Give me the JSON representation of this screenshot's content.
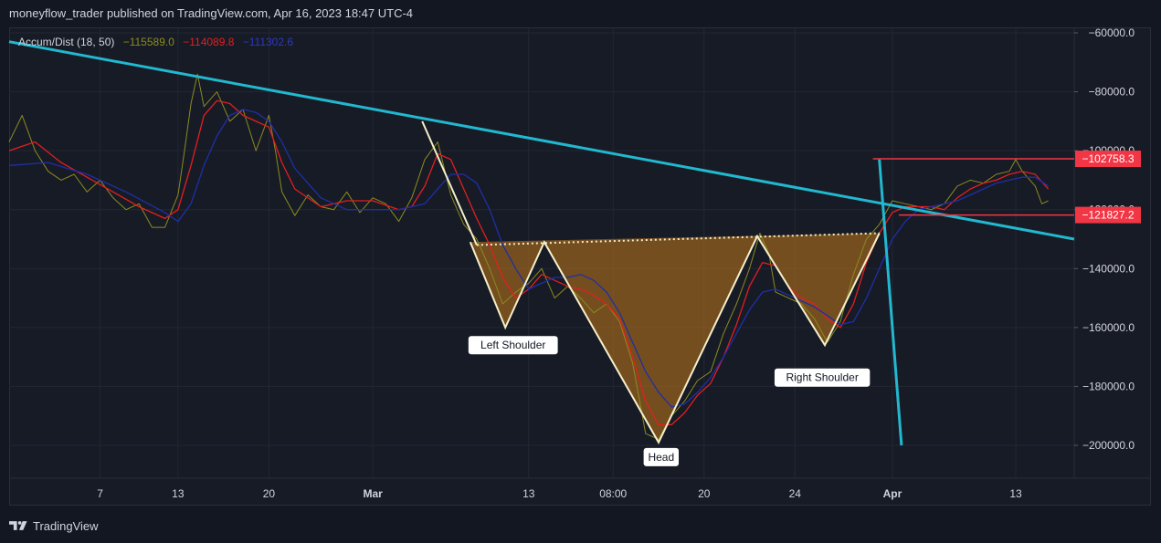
{
  "header": {
    "text": "moneyflow_trader published on TradingView.com, Apr 16, 2023 18:47 UTC-4"
  },
  "footer": {
    "brand": "TradingView",
    "logo_icon": "tradingview-logo-icon"
  },
  "indicator": {
    "name": "Accum/Dist (18, 50)",
    "value1": "−115589.0",
    "value2": "−114089.8",
    "value3": "−111302.6",
    "colors": {
      "raw": "#8b8b1e",
      "fast": "#e21f1f",
      "slow": "#1f2fa8"
    }
  },
  "chart_data": {
    "type": "line",
    "ylim": [
      -212000,
      -60000
    ],
    "y_ticks": [
      {
        "value": -60000,
        "label": "−60000.0"
      },
      {
        "value": -80000,
        "label": "−80000.0"
      },
      {
        "value": -100000,
        "label": "−100000.0"
      },
      {
        "value": -120000,
        "label": "−120000.0"
      },
      {
        "value": -140000,
        "label": "−140000.0"
      },
      {
        "value": -160000,
        "label": "−160000.0"
      },
      {
        "value": -180000,
        "label": "−180000.0"
      },
      {
        "value": -200000,
        "label": "−200000.0"
      }
    ],
    "x_ticks": [
      {
        "t": 7,
        "label": "7",
        "bold": false
      },
      {
        "t": 13,
        "label": "13",
        "bold": false
      },
      {
        "t": 20,
        "label": "20",
        "bold": false
      },
      {
        "t": 28,
        "label": "Mar",
        "bold": true
      },
      {
        "t": 40,
        "label": "13",
        "bold": false
      },
      {
        "t": 46.5,
        "label": "08:00",
        "bold": false
      },
      {
        "t": 53.5,
        "label": "20",
        "bold": false
      },
      {
        "t": 60.5,
        "label": "24",
        "bold": false
      },
      {
        "t": 68,
        "label": "Apr",
        "bold": true
      },
      {
        "t": 77.5,
        "label": "13",
        "bold": false
      }
    ],
    "xlim": [
      0,
      82
    ],
    "series": [
      {
        "role": "raw",
        "points": [
          [
            0,
            -97000
          ],
          [
            1,
            -88000
          ],
          [
            2,
            -100000
          ],
          [
            3,
            -107000
          ],
          [
            4,
            -110000
          ],
          [
            5,
            -108000
          ],
          [
            6,
            -114000
          ],
          [
            7,
            -110000
          ],
          [
            8,
            -116000
          ],
          [
            9,
            -120000
          ],
          [
            10,
            -118000
          ],
          [
            11,
            -126000
          ],
          [
            12,
            -126000
          ],
          [
            13,
            -115000
          ],
          [
            13.5,
            -100000
          ],
          [
            14,
            -84000
          ],
          [
            14.5,
            -74000
          ],
          [
            15,
            -85000
          ],
          [
            16,
            -80000
          ],
          [
            17,
            -90000
          ],
          [
            18,
            -86000
          ],
          [
            19,
            -100000
          ],
          [
            20,
            -88000
          ],
          [
            20.5,
            -100000
          ],
          [
            21,
            -114000
          ],
          [
            22,
            -122000
          ],
          [
            23,
            -115000
          ],
          [
            24,
            -119000
          ],
          [
            25,
            -120000
          ],
          [
            26,
            -114000
          ],
          [
            27,
            -121000
          ],
          [
            28,
            -116000
          ],
          [
            29,
            -118000
          ],
          [
            30,
            -124000
          ],
          [
            31,
            -116000
          ],
          [
            32,
            -103000
          ],
          [
            33,
            -97000
          ],
          [
            34,
            -115000
          ],
          [
            35,
            -125000
          ],
          [
            36,
            -130000
          ],
          [
            37,
            -140000
          ],
          [
            38,
            -152000
          ],
          [
            39,
            -148000
          ],
          [
            40,
            -145000
          ],
          [
            41,
            -140000
          ],
          [
            42,
            -150000
          ],
          [
            43,
            -146000
          ],
          [
            44,
            -150000
          ],
          [
            45,
            -155000
          ],
          [
            46,
            -152000
          ],
          [
            47,
            -158000
          ],
          [
            48,
            -172000
          ],
          [
            49,
            -196000
          ],
          [
            50,
            -198000
          ],
          [
            51,
            -190000
          ],
          [
            52,
            -185000
          ],
          [
            53,
            -178000
          ],
          [
            54,
            -175000
          ],
          [
            55,
            -162000
          ],
          [
            56,
            -152000
          ],
          [
            57,
            -140000
          ],
          [
            57.8,
            -128000
          ],
          [
            58.5,
            -135000
          ],
          [
            59,
            -148000
          ],
          [
            60,
            -150000
          ],
          [
            61,
            -152000
          ],
          [
            62,
            -157000
          ],
          [
            63,
            -165000
          ],
          [
            64,
            -158000
          ],
          [
            65,
            -142000
          ],
          [
            66,
            -130000
          ],
          [
            67,
            -125000
          ],
          [
            68,
            -117000
          ],
          [
            69,
            -118000
          ],
          [
            70,
            -119000
          ],
          [
            71,
            -120000
          ],
          [
            72,
            -118000
          ],
          [
            73,
            -112000
          ],
          [
            74,
            -110000
          ],
          [
            75,
            -111000
          ],
          [
            76,
            -108000
          ],
          [
            77,
            -107000
          ],
          [
            77.5,
            -103000
          ],
          [
            78,
            -107000
          ],
          [
            79,
            -112000
          ],
          [
            79.5,
            -118000
          ],
          [
            80,
            -117000
          ]
        ]
      },
      {
        "role": "fast",
        "points": [
          [
            0,
            -100000
          ],
          [
            2,
            -97000
          ],
          [
            4,
            -104000
          ],
          [
            6,
            -109000
          ],
          [
            8,
            -114000
          ],
          [
            10,
            -119000
          ],
          [
            12,
            -123000
          ],
          [
            13,
            -120000
          ],
          [
            14,
            -105000
          ],
          [
            15,
            -88000
          ],
          [
            16,
            -83000
          ],
          [
            17,
            -84000
          ],
          [
            18,
            -88000
          ],
          [
            19,
            -90000
          ],
          [
            20,
            -92000
          ],
          [
            21,
            -104000
          ],
          [
            22,
            -113000
          ],
          [
            24,
            -119000
          ],
          [
            26,
            -117000
          ],
          [
            28,
            -117000
          ],
          [
            30,
            -120000
          ],
          [
            31,
            -119000
          ],
          [
            32,
            -112000
          ],
          [
            33,
            -101000
          ],
          [
            34,
            -103000
          ],
          [
            35,
            -113000
          ],
          [
            36,
            -123000
          ],
          [
            37,
            -132000
          ],
          [
            38,
            -143000
          ],
          [
            39,
            -150000
          ],
          [
            40,
            -147000
          ],
          [
            41,
            -142000
          ],
          [
            42,
            -144000
          ],
          [
            43,
            -146000
          ],
          [
            44,
            -147000
          ],
          [
            45,
            -149000
          ],
          [
            46,
            -152000
          ],
          [
            47,
            -157000
          ],
          [
            48,
            -170000
          ],
          [
            49,
            -185000
          ],
          [
            50,
            -193000
          ],
          [
            51,
            -193000
          ],
          [
            52,
            -189000
          ],
          [
            53,
            -183000
          ],
          [
            54,
            -179000
          ],
          [
            55,
            -170000
          ],
          [
            56,
            -159000
          ],
          [
            57,
            -146000
          ],
          [
            58,
            -138000
          ],
          [
            59,
            -139000
          ],
          [
            60,
            -146000
          ],
          [
            61,
            -150000
          ],
          [
            62,
            -152000
          ],
          [
            63,
            -157000
          ],
          [
            64,
            -160000
          ],
          [
            65,
            -152000
          ],
          [
            66,
            -138000
          ],
          [
            67,
            -128000
          ],
          [
            68,
            -121000
          ],
          [
            69,
            -119000
          ],
          [
            70,
            -119000
          ],
          [
            71,
            -119000
          ],
          [
            72,
            -120000
          ],
          [
            73,
            -116000
          ],
          [
            74,
            -113000
          ],
          [
            75,
            -111000
          ],
          [
            76,
            -110000
          ],
          [
            77,
            -108000
          ],
          [
            78,
            -107000
          ],
          [
            79,
            -108000
          ],
          [
            80,
            -113000
          ]
        ]
      },
      {
        "role": "slow",
        "points": [
          [
            0,
            -105000
          ],
          [
            3,
            -104000
          ],
          [
            6,
            -108000
          ],
          [
            9,
            -114000
          ],
          [
            12,
            -121000
          ],
          [
            13,
            -124000
          ],
          [
            14,
            -118000
          ],
          [
            15,
            -105000
          ],
          [
            16,
            -95000
          ],
          [
            17,
            -88000
          ],
          [
            18,
            -86000
          ],
          [
            19,
            -87000
          ],
          [
            20,
            -90000
          ],
          [
            21,
            -97000
          ],
          [
            22,
            -106000
          ],
          [
            24,
            -116000
          ],
          [
            26,
            -120000
          ],
          [
            28,
            -120000
          ],
          [
            30,
            -120000
          ],
          [
            32,
            -118000
          ],
          [
            33,
            -113000
          ],
          [
            34,
            -108000
          ],
          [
            35,
            -108000
          ],
          [
            36,
            -111000
          ],
          [
            37,
            -120000
          ],
          [
            38,
            -132000
          ],
          [
            39,
            -140000
          ],
          [
            40,
            -147000
          ],
          [
            41,
            -145000
          ],
          [
            42,
            -143000
          ],
          [
            43,
            -143000
          ],
          [
            44,
            -142000
          ],
          [
            45,
            -144000
          ],
          [
            46,
            -148000
          ],
          [
            47,
            -155000
          ],
          [
            48,
            -165000
          ],
          [
            49,
            -175000
          ],
          [
            50,
            -182000
          ],
          [
            51,
            -187000
          ],
          [
            52,
            -186000
          ],
          [
            53,
            -182000
          ],
          [
            54,
            -177000
          ],
          [
            55,
            -170000
          ],
          [
            56,
            -162000
          ],
          [
            57,
            -154000
          ],
          [
            58,
            -148000
          ],
          [
            59,
            -147000
          ],
          [
            60,
            -149000
          ],
          [
            61,
            -151000
          ],
          [
            62,
            -153000
          ],
          [
            63,
            -156000
          ],
          [
            64,
            -159000
          ],
          [
            65,
            -158000
          ],
          [
            66,
            -150000
          ],
          [
            67,
            -140000
          ],
          [
            68,
            -130000
          ],
          [
            69,
            -124000
          ],
          [
            70,
            -120000
          ],
          [
            71,
            -119000
          ],
          [
            72,
            -118000
          ],
          [
            73,
            -117000
          ],
          [
            74,
            -115000
          ],
          [
            75,
            -113000
          ],
          [
            76,
            -111000
          ],
          [
            77,
            -110000
          ],
          [
            78,
            -109000
          ],
          [
            79,
            -109000
          ],
          [
            80,
            -112000
          ]
        ]
      }
    ],
    "trendlines": [
      {
        "name": "descending-trendline",
        "points": [
          [
            0,
            -63000
          ],
          [
            82,
            -130000
          ]
        ]
      },
      {
        "name": "breakout-vertical-line",
        "points": [
          [
            67,
            -103000
          ],
          [
            68.7,
            -200000
          ]
        ]
      }
    ],
    "neckline": [
      [
        36,
        -132000
      ],
      [
        67,
        -128000
      ]
    ],
    "pattern_path": [
      [
        35.5,
        -131000
      ],
      [
        38.2,
        -160000
      ],
      [
        41.2,
        -131000
      ],
      [
        50,
        -199000
      ],
      [
        57.6,
        -129000
      ],
      [
        62.8,
        -166000
      ],
      [
        67,
        -128000
      ]
    ],
    "pattern_lead_in": [
      [
        31.8,
        -90000
      ],
      [
        36,
        -132000
      ]
    ],
    "pattern_labels": [
      {
        "text": "Left Shoulder",
        "x": 38.8,
        "y": -166000
      },
      {
        "text": "Head",
        "x": 50.2,
        "y": -204000
      },
      {
        "text": "Right Shoulder",
        "x": 62.6,
        "y": -177000
      }
    ],
    "horizontal_levels": [
      {
        "value": -102758.3,
        "label": "−102758.3",
        "from_x": 66.5
      },
      {
        "value": -121827.2,
        "label": "−121827.2",
        "from_x": 68.5
      }
    ]
  }
}
